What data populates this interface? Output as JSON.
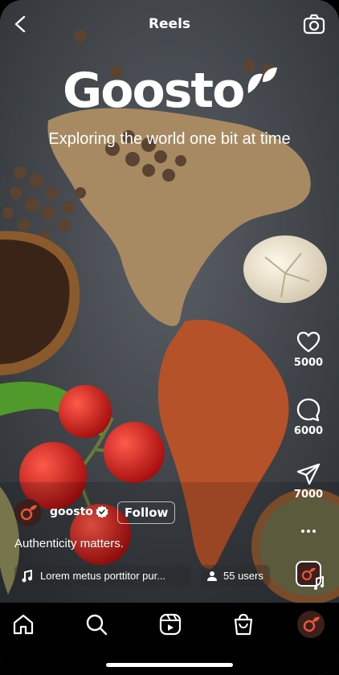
{
  "header": {
    "title": "Reels"
  },
  "brand": {
    "logo_text": "Goosto",
    "tagline": "Exploring the world one bit at time"
  },
  "actions": {
    "likes": "5000",
    "comments": "6000",
    "shares": "7000"
  },
  "author": {
    "name": "goosto",
    "follow_label": "Follow"
  },
  "caption": "Authenticity matters.",
  "audio": {
    "track": "Lorem metus porttitor pur..."
  },
  "users": {
    "label": "55 users"
  },
  "colors": {
    "accent": "#e8553c",
    "nav_bg": "#000000"
  },
  "icons": [
    "back-icon",
    "camera-icon",
    "heart-icon",
    "comment-icon",
    "share-icon",
    "more-icon",
    "music-note-icon",
    "users-icon",
    "home-icon",
    "search-icon",
    "reels-icon",
    "shop-icon",
    "profile-icon"
  ]
}
